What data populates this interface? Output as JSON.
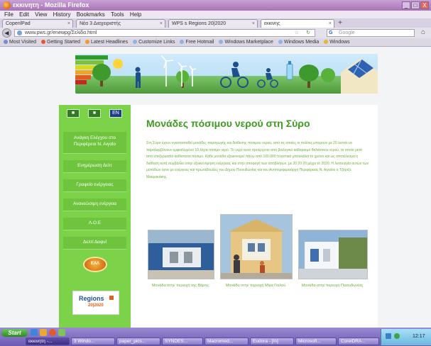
{
  "window": {
    "title": "εκκινητη - Mozilla Firefox",
    "controls": {
      "minimize": "_",
      "maximize": "□",
      "close": "X"
    }
  },
  "menu": [
    "File",
    "Edit",
    "View",
    "History",
    "Bookmarks",
    "Tools",
    "Help"
  ],
  "tabs": [
    {
      "label": "CopenlPad"
    },
    {
      "label": "Νέα 3 Διαχειριστής"
    },
    {
      "label": "WPS s Regions 20|2020"
    },
    {
      "label": "εκκινης"
    }
  ],
  "nav": {
    "url": "www.pws.gr/enewpg/Σελίδα.html",
    "search_placeholder": "Google",
    "search_engine": "G"
  },
  "bookmarks": [
    "Most Visited",
    "Getting Started",
    "Latest Headlines",
    "Customize Links",
    "Free Hotmail",
    "Windows Marketplace",
    "Windows Media",
    "Windows"
  ],
  "site": {
    "lang_buttons": [
      "■",
      "■",
      "EN"
    ],
    "menu": [
      "Ανάγκη Ελέγχου στο Περιφέρεια Ν. Αιγαίο",
      "Ενημέρωση Δελτ",
      "Γραφείο ενέργειας",
      "Ανανεώσιμη ενέργεια",
      "Λ.Ο.Ε",
      "Δελτί Δαφνί"
    ],
    "sun_label": "ΕΛΛ",
    "regions_logo": "Regions",
    "regions_sub": "20|2020",
    "page_title": "Μονάδες πόσιμου νερού στη Σύρο",
    "intro": "Στη Σύρο έχουν εγκατασταθεί μονάδες παραγωγής και διάθεσης πόσιμου νερού, από τις οποίες οι πολίτες μπορούν με 20 λεπτά να παραλαμβάνουν εμφιαλωμένο 10 λίτρα πόσιμο νερό. Το νερό αυτό προέρχεται από βιολογικό καθαρισμό θαλάσσιου νερού, το οποίο μετά από επεξεργασία καθίσταται πόσιμο. Κάθε μονάδα εξοικονομεί πάνω από 100.000 πλαστικά μπουκάλια το χρόνο και ως αποτέλεσμα η διάθεση αυτή συμβάλλει στην εξοικονόμηση ενέργειας και στην αποφυγή των αποβλήτων, με 20 20 20 μέχρι το 2020. Η λειτουργία αυτών των μονάδων έγινε με ενέργειες και πρωτοβουλίες του Δήμου Ποσειδωνίας και του Αντιπεριφερειάρχη Περιφέρειας Ν. Αιγαίου ο Τζόρτζε Μακρακάκης.",
    "photos": [
      {
        "caption": "Μονάδα στην περιοχή της Βάρης"
      },
      {
        "caption": "Μονάδα στην περιοχή Μίγα Γιαλού"
      },
      {
        "caption": "Μονάδα στην περιοχή Ποσειδωνίας"
      }
    ]
  },
  "taskbar": {
    "start": "Start",
    "tasks": [
      "εκκινητη -...",
      "3 Windo...",
      "paper_pics...",
      "SYNDES...",
      "Macromed...",
      "Eudora - [In]",
      "Microsoft...",
      "CorelDRA..."
    ],
    "clock": "12:17"
  },
  "colors": {
    "title_bar": "#a874b8",
    "sidebar": "#7cd34a",
    "heading": "#3d9c1f",
    "body_text": "#6fae3d",
    "taskbar": "#6b59b3"
  }
}
